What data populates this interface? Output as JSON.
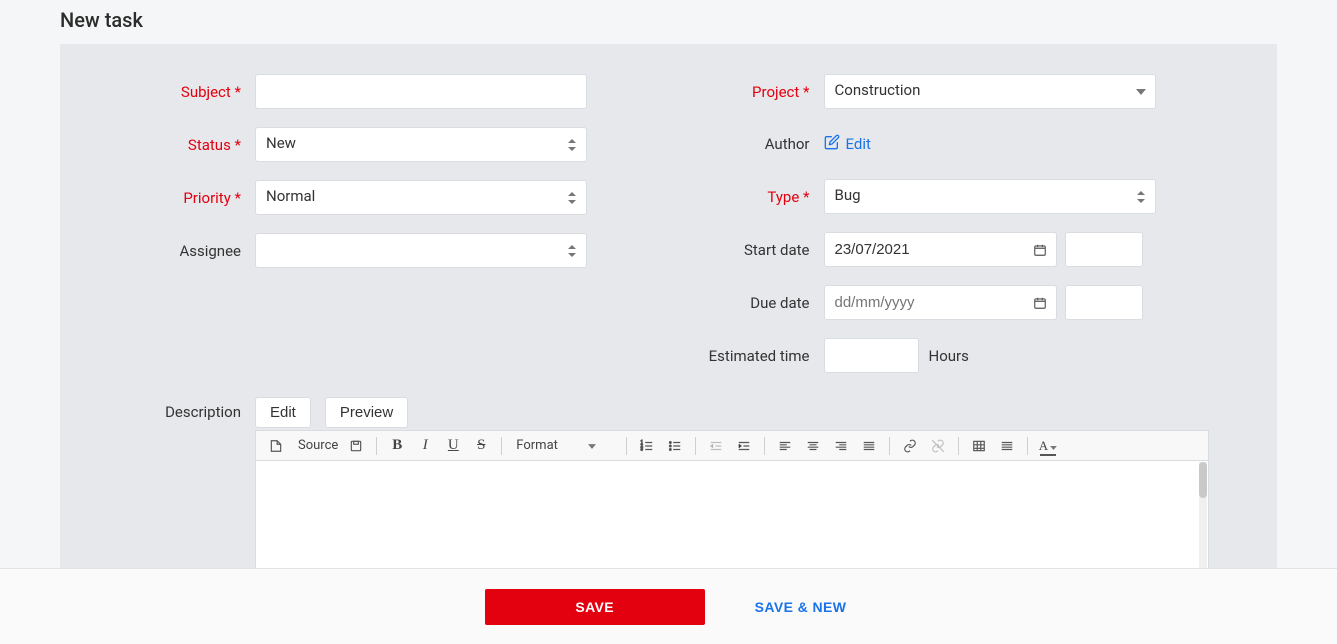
{
  "page": {
    "title": "New task"
  },
  "left": {
    "subject": {
      "label": "Subject",
      "value": ""
    },
    "status": {
      "label": "Status",
      "value": "New"
    },
    "priority": {
      "label": "Priority",
      "value": "Normal"
    },
    "assignee": {
      "label": "Assignee",
      "value": ""
    }
  },
  "right": {
    "project": {
      "label": "Project",
      "value": "Construction"
    },
    "author": {
      "label": "Author",
      "edit_label": "Edit"
    },
    "type": {
      "label": "Type",
      "value": "Bug"
    },
    "start": {
      "label": "Start date",
      "value": "23/07/2021",
      "extra": ""
    },
    "due": {
      "label": "Due date",
      "value": "",
      "placeholder": "dd/mm/yyyy",
      "extra": ""
    },
    "est": {
      "label": "Estimated time",
      "value": "",
      "unit": "Hours"
    }
  },
  "description": {
    "label": "Description",
    "tabs": {
      "edit": "Edit",
      "preview": "Preview"
    },
    "toolbar": {
      "source": "Source",
      "format": "Format"
    },
    "content": ""
  },
  "footer": {
    "save": "SAVE",
    "save_new": "SAVE & NEW"
  }
}
